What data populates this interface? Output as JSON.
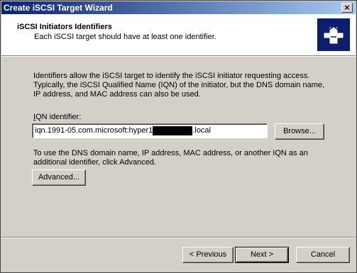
{
  "window": {
    "title": "Create iSCSI Target Wizard",
    "close_glyph": "×"
  },
  "header": {
    "title": "iSCSI Initiators Identifiers",
    "subtitle": "Each iSCSI target should have at least one identifier.",
    "icon": "wizard-puzzle-icon"
  },
  "main": {
    "description": "Identifiers allow the iSCSI target to identify the iSCSI initiator requesting access. Typically, the iSCSI Qualified Name (IQN) of the initiator, but the DNS domain name, IP address, and MAC address can also be used.",
    "iqn_label": "IQN identifier:",
    "iqn_value_prefix": "iqn.1991-05.com.microsoft:hyper1",
    "iqn_value_suffix": ".local",
    "browse_label": "Browse...",
    "advanced_text": "To use the DNS domain name, IP address, MAC address, or another IQN as an additional identifier, click Advanced.",
    "advanced_label": "Advanced..."
  },
  "footer": {
    "previous_label": "< Previous",
    "next_label": "Next >",
    "cancel_label": "Cancel"
  }
}
